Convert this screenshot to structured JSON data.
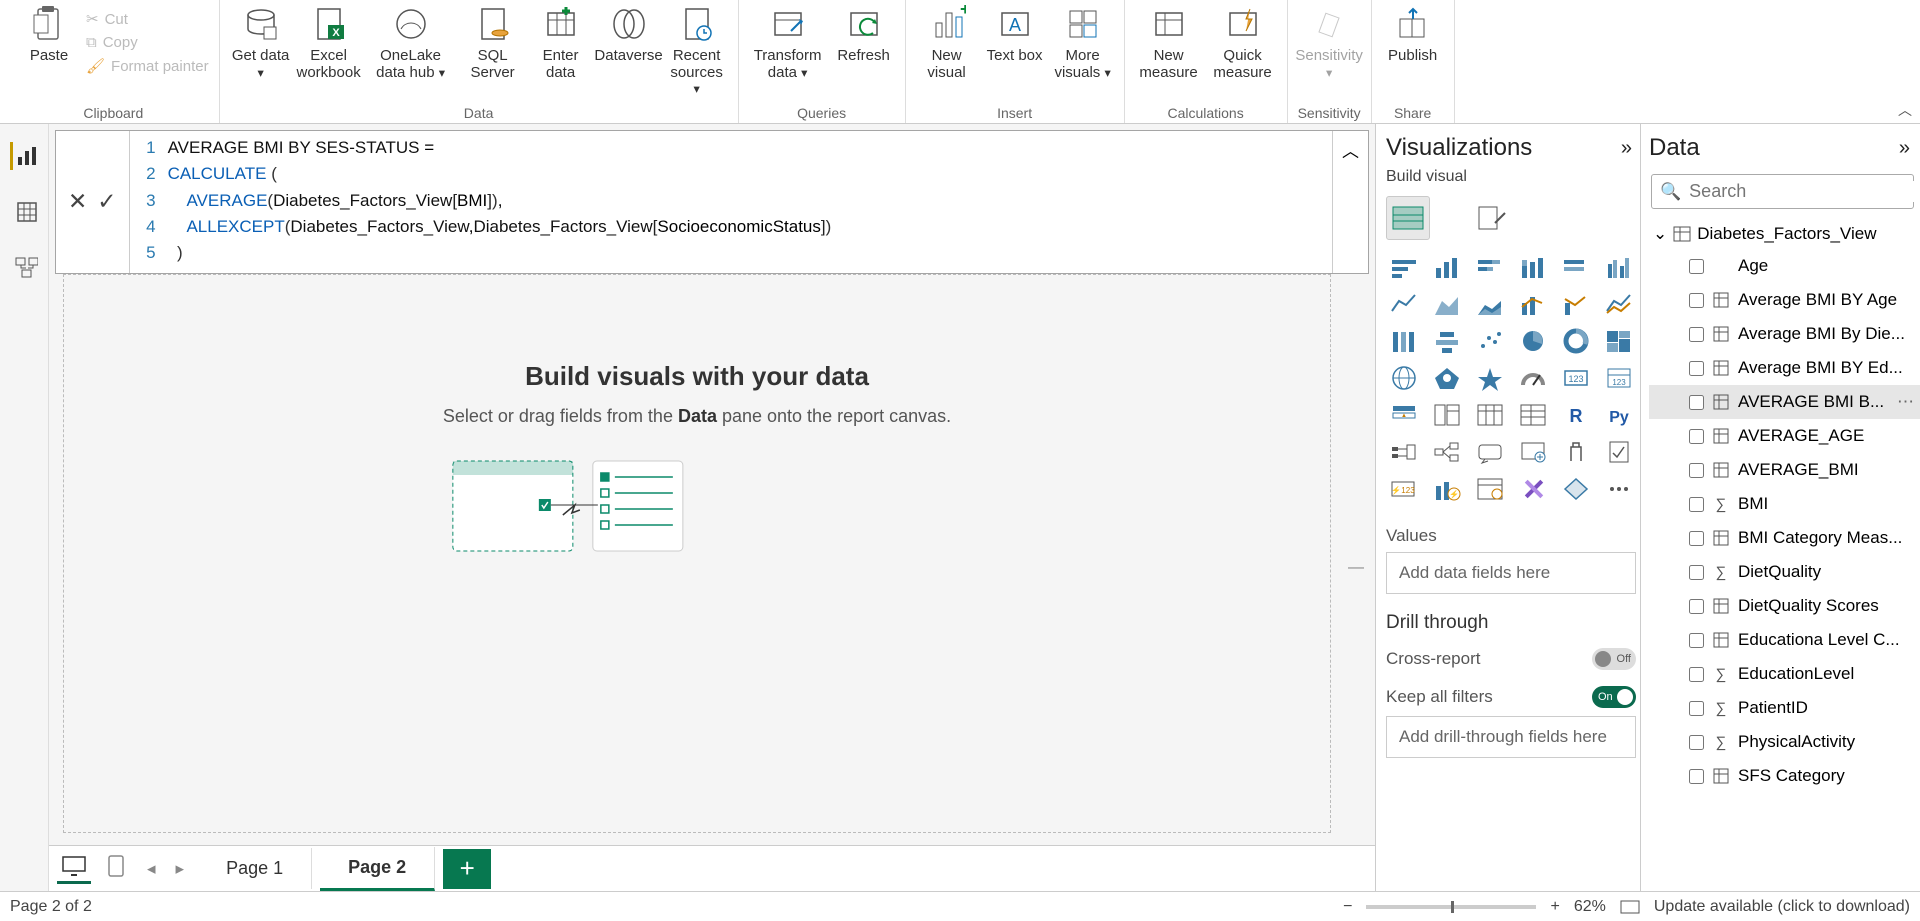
{
  "ribbon": {
    "clipboard": {
      "paste": "Paste",
      "cut": "Cut",
      "copy": "Copy",
      "format_painter": "Format painter",
      "label": "Clipboard"
    },
    "data": {
      "get_data": "Get data",
      "excel": "Excel workbook",
      "onelake": "OneLake data hub",
      "sql": "SQL Server",
      "enter": "Enter data",
      "dataverse": "Dataverse",
      "recent": "Recent sources",
      "label": "Data"
    },
    "queries": {
      "transform": "Transform data",
      "refresh": "Refresh",
      "label": "Queries"
    },
    "insert": {
      "new_visual": "New visual",
      "text_box": "Text box",
      "more_visuals": "More visuals",
      "label": "Insert"
    },
    "calculations": {
      "new_measure": "New measure",
      "quick_measure": "Quick measure",
      "label": "Calculations"
    },
    "sensitivity": {
      "btn": "Sensitivity",
      "label": "Sensitivity"
    },
    "share": {
      "publish": "Publish",
      "label": "Share"
    }
  },
  "formula": {
    "lines": [
      "AVERAGE BMI BY SES-STATUS =",
      "CALCULATE (",
      "    AVERAGE(Diabetes_Factors_View[BMI]),",
      "    ALLEXCEPT(Diabetes_Factors_View,Diabetes_Factors_View[SocioeconomicStatus])",
      "  )"
    ]
  },
  "canvas": {
    "title": "Build visuals with your data",
    "hint_pre": "Select or drag fields from the ",
    "hint_bold": "Data",
    "hint_post": " pane onto the report canvas."
  },
  "pagetabs": {
    "page1": "Page 1",
    "page2": "Page 2"
  },
  "vis": {
    "title": "Visualizations",
    "subtitle": "Build visual",
    "values": "Values",
    "values_placeholder": "Add data fields here",
    "drill": "Drill through",
    "cross": "Cross-report",
    "cross_state": "Off",
    "keep": "Keep all filters",
    "keep_state": "On",
    "drill_placeholder": "Add drill-through fields here"
  },
  "data_pane": {
    "title": "Data",
    "search_placeholder": "Search",
    "table": "Diabetes_Factors_View",
    "fields": [
      {
        "label": "Age",
        "icon": "none"
      },
      {
        "label": "Average BMI BY Age",
        "icon": "measure"
      },
      {
        "label": "Average BMI By Die...",
        "icon": "measure"
      },
      {
        "label": "Average BMI BY Ed...",
        "icon": "measure"
      },
      {
        "label": "AVERAGE BMI B...",
        "icon": "measure",
        "selected": true
      },
      {
        "label": "AVERAGE_AGE",
        "icon": "measure"
      },
      {
        "label": "AVERAGE_BMI",
        "icon": "measure"
      },
      {
        "label": "BMI",
        "icon": "sigma"
      },
      {
        "label": "BMI Category Meas...",
        "icon": "measure"
      },
      {
        "label": "DietQuality",
        "icon": "sigma"
      },
      {
        "label": "DietQuality Scores",
        "icon": "measure"
      },
      {
        "label": "Educationa Level C...",
        "icon": "measure"
      },
      {
        "label": "EducationLevel",
        "icon": "sigma"
      },
      {
        "label": "PatientID",
        "icon": "sigma"
      },
      {
        "label": "PhysicalActivity",
        "icon": "sigma"
      },
      {
        "label": "SFS Category",
        "icon": "measure"
      }
    ]
  },
  "status": {
    "left": "Page 2 of 2",
    "zoom": "62%",
    "update": "Update available (click to download)"
  }
}
